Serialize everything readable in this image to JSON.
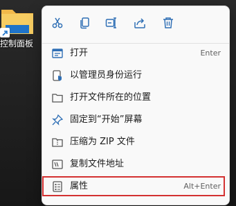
{
  "desktop": {
    "icon_label": "控制面板",
    "accent": "#f6c44a"
  },
  "toolbar": {
    "buttons": [
      {
        "icon": "cut-icon"
      },
      {
        "icon": "copy-icon"
      },
      {
        "icon": "rename-icon"
      },
      {
        "icon": "share-icon"
      },
      {
        "icon": "delete-icon"
      }
    ],
    "icon_color": "#2f6fb5"
  },
  "menu": {
    "items": [
      {
        "label": "打开",
        "shortcut": "Enter",
        "icon": "open-icon"
      },
      {
        "label": "以管理员身份运行",
        "shortcut": "",
        "icon": "run-as-admin-icon"
      },
      {
        "label": "打开文件所在的位置",
        "shortcut": "",
        "icon": "folder-icon"
      },
      {
        "label": "固定到“开始”屏幕",
        "shortcut": "",
        "icon": "pin-icon"
      },
      {
        "label": "压缩为 ZIP 文件",
        "shortcut": "",
        "icon": "zip-icon"
      },
      {
        "label": "复制文件地址",
        "shortcut": "",
        "icon": "copy-path-icon"
      },
      {
        "label": "属性",
        "shortcut": "Alt+Enter",
        "icon": "properties-icon"
      }
    ],
    "highlight_color": "#d33131"
  }
}
